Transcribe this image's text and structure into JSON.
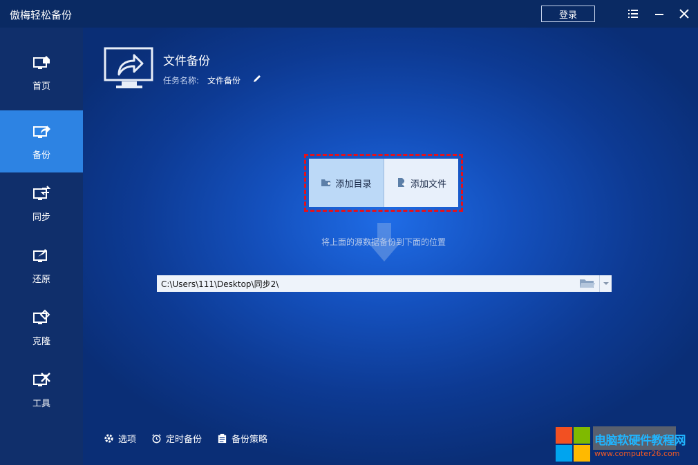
{
  "titlebar": {
    "app_title": "傲梅轻松备份",
    "login_label": "登录",
    "menu_icon": "menu-icon",
    "minimize_icon": "minimize-icon",
    "close_icon": "close-icon"
  },
  "sidebar": {
    "items": [
      {
        "label": "首页",
        "icon": "home-monitor-icon"
      },
      {
        "label": "备份",
        "icon": "backup-monitor-icon",
        "active": true
      },
      {
        "label": "同步",
        "icon": "sync-monitor-icon"
      },
      {
        "label": "还原",
        "icon": "restore-monitor-icon"
      },
      {
        "label": "克隆",
        "icon": "clone-monitor-icon"
      },
      {
        "label": "工具",
        "icon": "tools-monitor-icon"
      }
    ]
  },
  "main": {
    "title": "文件备份",
    "task_label": "任务名称:",
    "task_name": "文件备份",
    "add_directory": "添加目录",
    "add_file": "添加文件",
    "hint": "将上面的源数据备份到下面的位置",
    "destination_path": "C:\\Users\\111\\Desktop\\同步2\\"
  },
  "bottom": {
    "options": "选项",
    "schedule": "定时备份",
    "strategy": "备份策略"
  },
  "watermark": {
    "title": "电脑软硬件教程网",
    "url": "www.computer26.com"
  },
  "colors": {
    "active_nav": "#2d83e3",
    "highlight_border": "#e3121c",
    "titlebar": "#0a2a63"
  }
}
